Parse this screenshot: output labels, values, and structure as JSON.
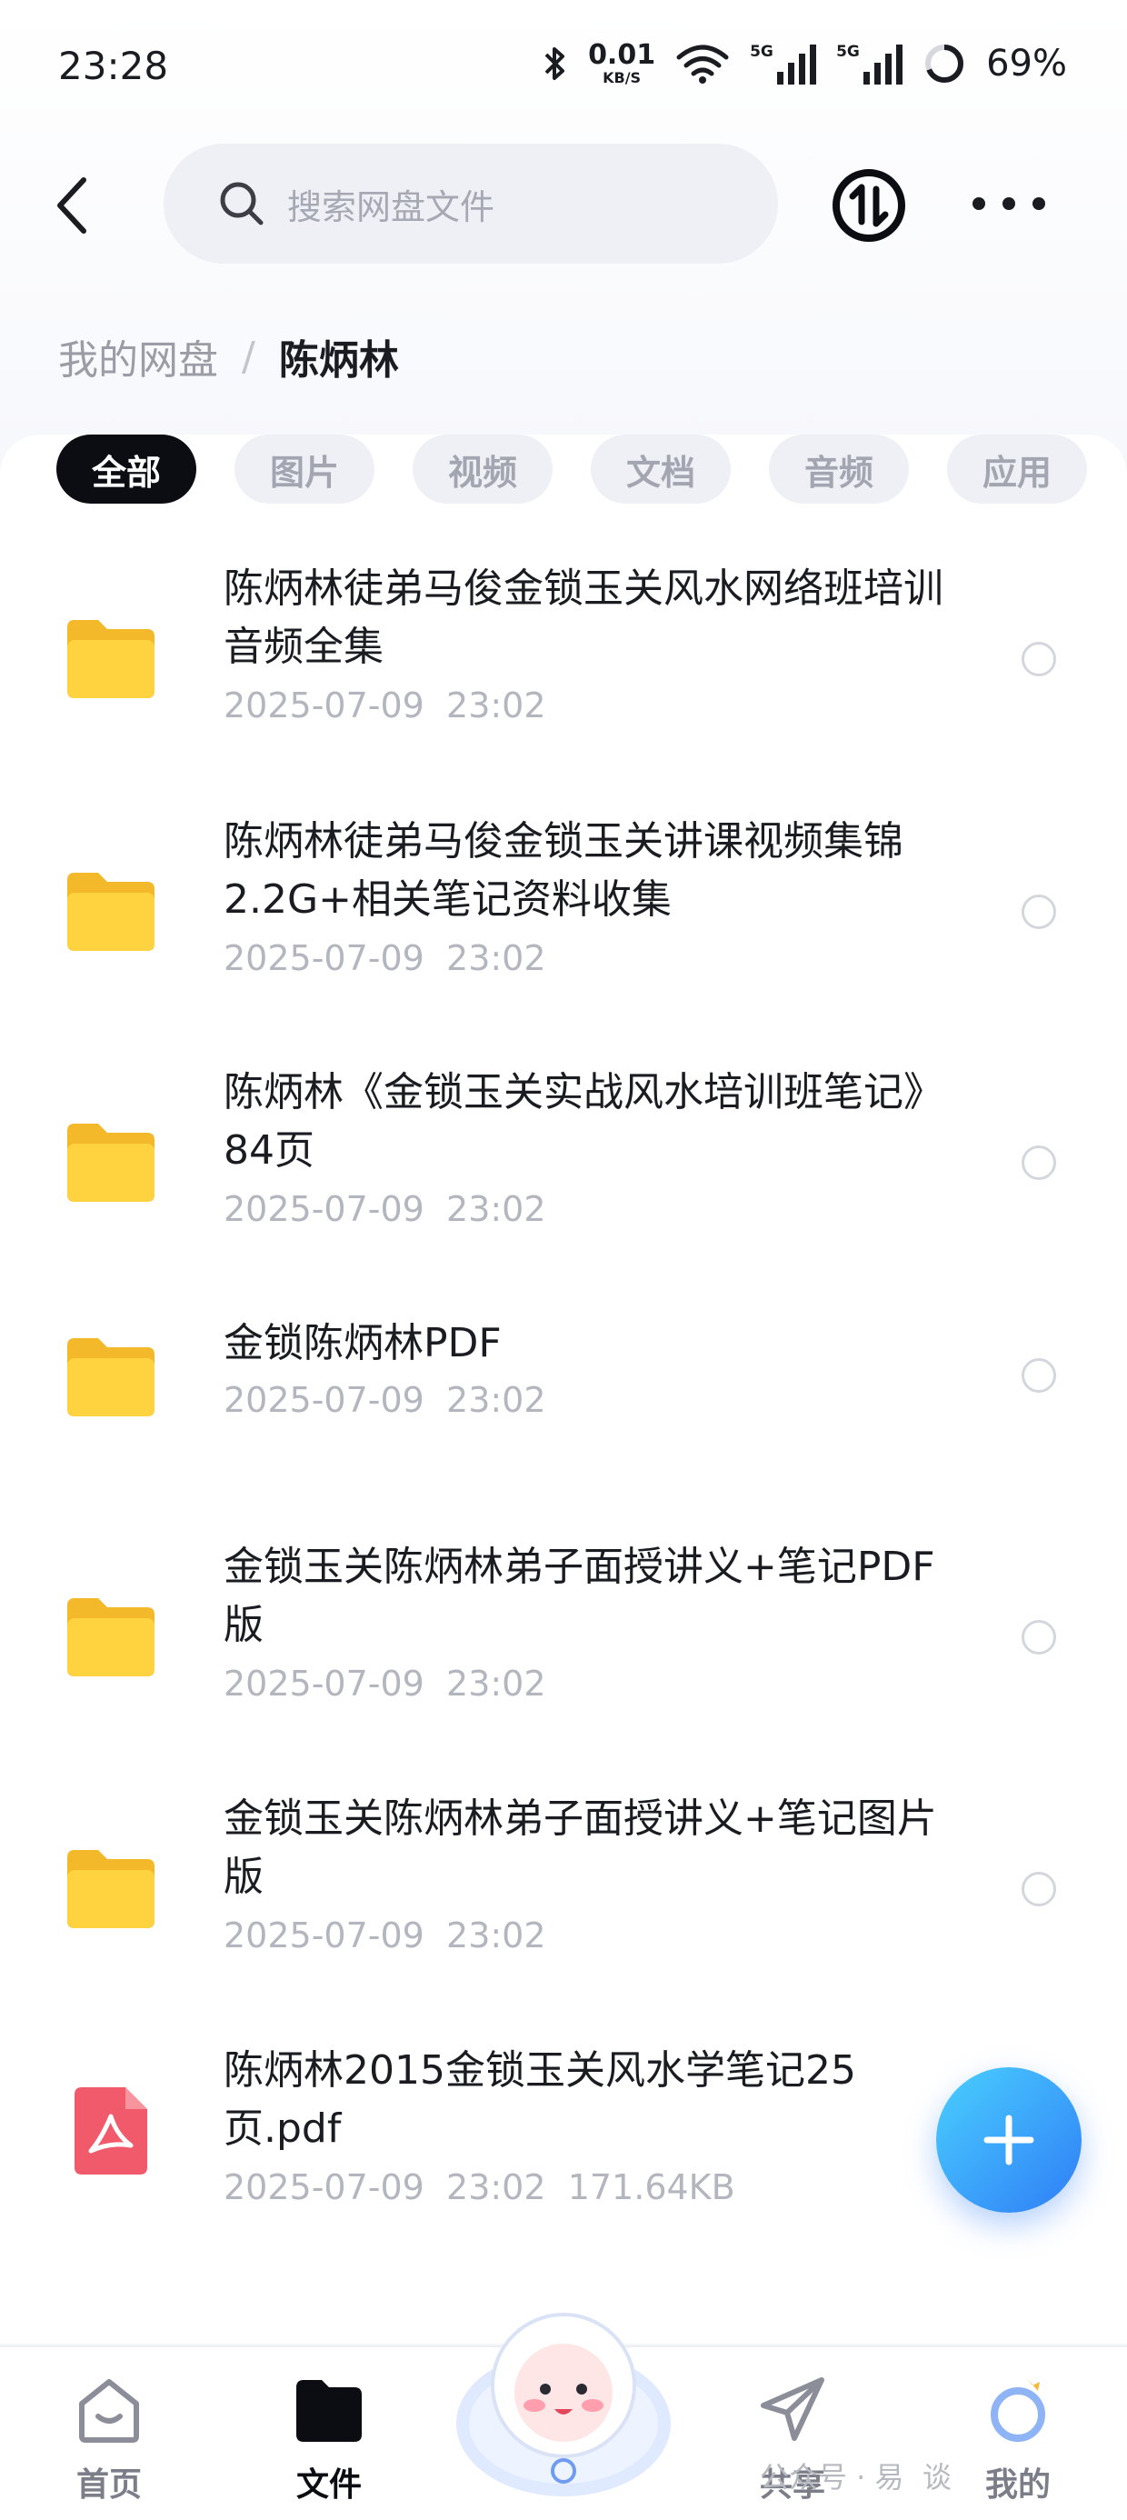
{
  "status_bar": {
    "time": "23:28",
    "net_speed_value": "0.01",
    "net_speed_unit": "KB/S",
    "sim1_label": "5G",
    "sim2_label": "5G",
    "battery": "69%",
    "icons": [
      "bluetooth-icon",
      "wifi-icon",
      "signal-icon",
      "battery-ring-icon"
    ]
  },
  "header": {
    "search_placeholder": "搜索网盘文件"
  },
  "breadcrumb": {
    "root": "我的网盘",
    "separator": "/",
    "current": "陈炳林"
  },
  "filter_tabs": [
    "全部",
    "图片",
    "视频",
    "文档",
    "音频",
    "应用"
  ],
  "active_tab": "全部",
  "files": [
    {
      "type": "folder",
      "name": "陈炳林徒弟马俊金锁玉关风水网络班培训音频全集",
      "date": "2025-07-09",
      "time": "23:02",
      "size": ""
    },
    {
      "type": "folder",
      "name": "陈炳林徒弟马俊金锁玉关讲课视频集锦2.2G+相关笔记资料收集",
      "date": "2025-07-09",
      "time": "23:02",
      "size": ""
    },
    {
      "type": "folder",
      "name": "陈炳林《金锁玉关实战风水培训班笔记》84页",
      "date": "2025-07-09",
      "time": "23:02",
      "size": ""
    },
    {
      "type": "folder",
      "name": "金锁陈炳林PDF",
      "date": "2025-07-09",
      "time": "23:02",
      "size": ""
    },
    {
      "type": "folder",
      "name": "金锁玉关陈炳林弟子面授讲义+笔记PDF版",
      "date": "2025-07-09",
      "time": "23:02",
      "size": ""
    },
    {
      "type": "folder",
      "name": "金锁玉关陈炳林弟子面授讲义+笔记图片版",
      "date": "2025-07-09",
      "time": "23:02",
      "size": ""
    },
    {
      "type": "pdf",
      "name": "陈炳林2015金锁玉关风水学笔记25页.pdf",
      "date": "2025-07-09",
      "time": "23:02",
      "size": "171.64KB"
    }
  ],
  "bottom_nav": [
    {
      "label": "首页",
      "icon": "home-icon",
      "active": false
    },
    {
      "label": "文件",
      "icon": "folder-icon",
      "active": true
    },
    {
      "label": "共享",
      "icon": "paper-plane-icon",
      "active": false
    },
    {
      "label": "我的",
      "icon": "profile-ring-icon",
      "active": false
    }
  ],
  "watermark": "公众号 · 易  谈",
  "colors": {
    "accent": "#2f7df6",
    "folder": "#ffd23f",
    "pdf": "#f05a6a",
    "active_tab_bg": "#0b0d13"
  }
}
